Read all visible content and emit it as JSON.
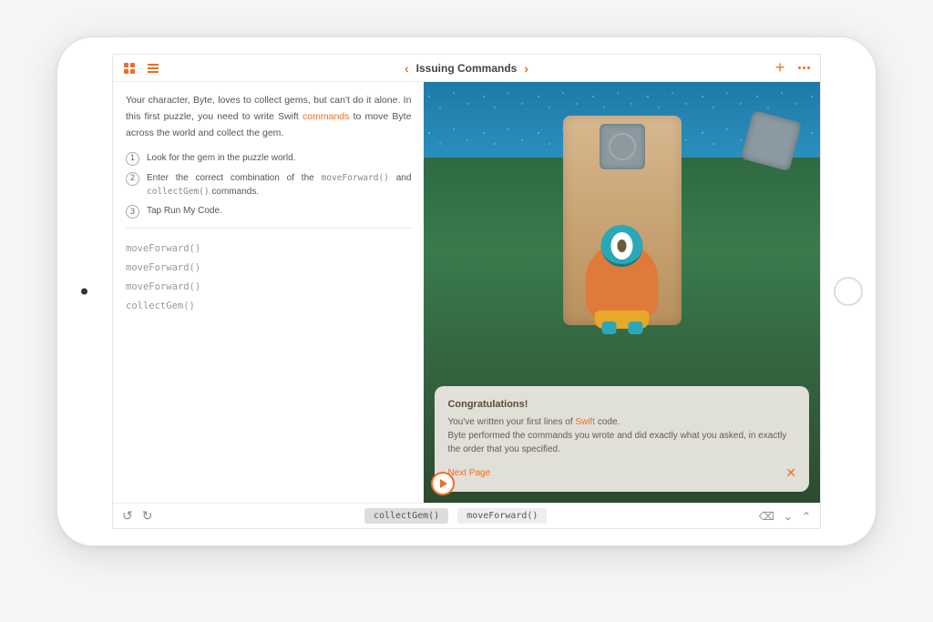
{
  "topbar": {
    "title": "Issuing Commands"
  },
  "intro": {
    "prefix": "Your character, Byte, loves to collect gems, but can't do it alone. In this first puzzle, you need to write Swift ",
    "link": "commands",
    "suffix": " to move Byte across the world and collect the gem."
  },
  "steps": [
    {
      "num": "1",
      "text": "Look for the gem in the puzzle world."
    },
    {
      "num": "2",
      "prefix": "Enter the correct combination of the ",
      "code1": "moveForward()",
      "mid": " and ",
      "code2": "collectGem()",
      "suffix": " commands."
    },
    {
      "num": "3",
      "text": "Tap Run My Code."
    }
  ],
  "editor": {
    "lines": [
      "moveForward()",
      "moveForward()",
      "moveForward()",
      "collectGem()"
    ]
  },
  "popup": {
    "title": "Congratulations!",
    "line1a": "You've written your first lines of ",
    "swift": "Swift",
    "line1b": " code.",
    "line2": "Byte performed the commands you wrote and did exactly what you asked, in exactly the order that you specified.",
    "next": "Next Page"
  },
  "bottombar": {
    "chip1": "collectGem()",
    "chip2": "moveForward()",
    "backspace": "⌫",
    "down": "⌄",
    "up": "⌃"
  }
}
